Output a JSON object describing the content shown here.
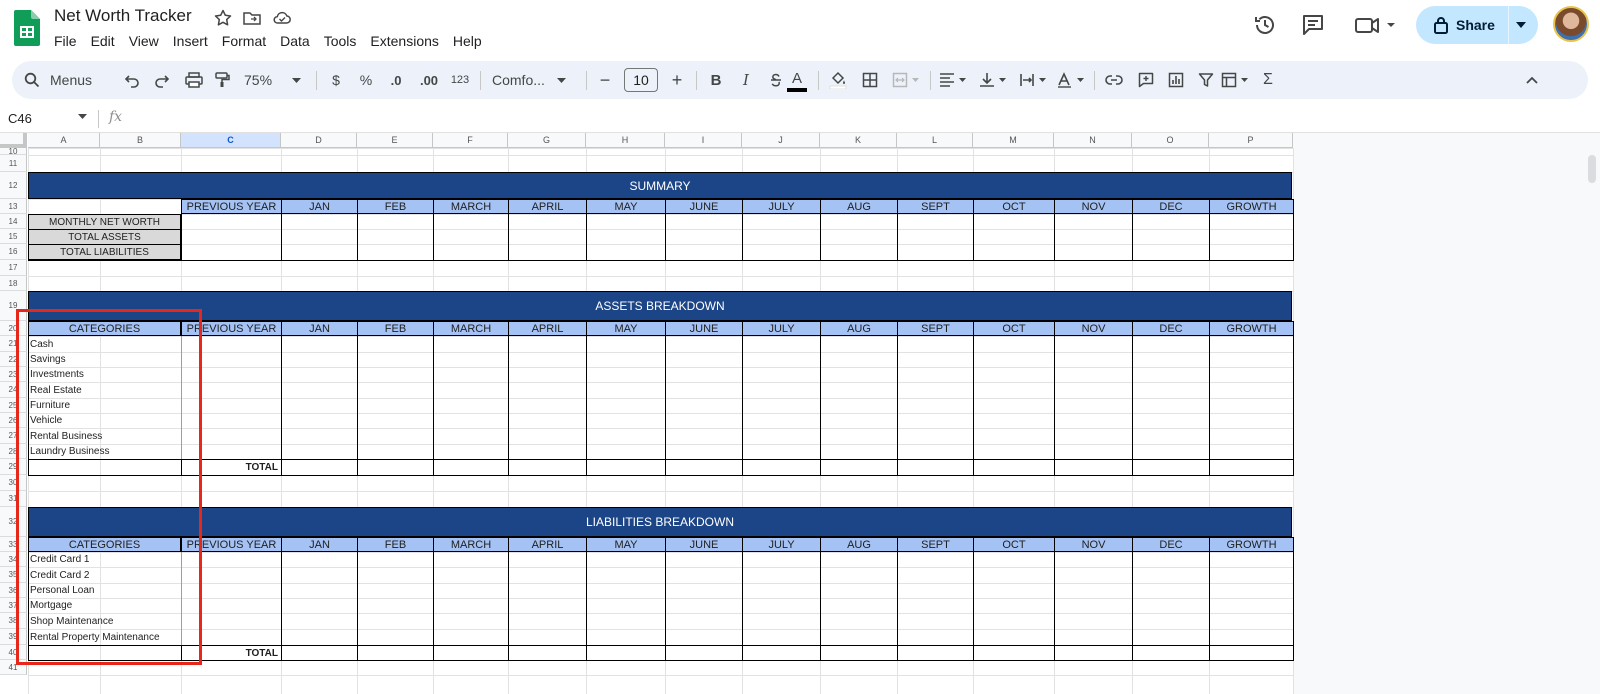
{
  "app": {
    "title": "Net Worth Tracker",
    "menu": [
      "File",
      "Edit",
      "View",
      "Insert",
      "Format",
      "Data",
      "Tools",
      "Extensions",
      "Help"
    ],
    "share_label": "Share"
  },
  "toolbar": {
    "search_label": "Menus",
    "zoom": "75%",
    "currency": "$",
    "percent": "%",
    "dec_decrease": ".0",
    "dec_increase": ".00",
    "number_format": "123",
    "font_name": "Comfo...",
    "font_size": "10",
    "minus": "−",
    "plus": "+",
    "bold": "B",
    "italic": "I",
    "text_color_glyph": "A",
    "sum_glyph": "Σ"
  },
  "formula_bar": {
    "cell_ref": "C46",
    "fx": "fx"
  },
  "columns": [
    "A",
    "B",
    "C",
    "D",
    "E",
    "F",
    "G",
    "H",
    "I",
    "J",
    "K",
    "L",
    "M",
    "N",
    "O",
    "P"
  ],
  "selected_column": "C",
  "rows": [
    "10",
    "11",
    "12",
    "13",
    "14",
    "15",
    "16",
    "17",
    "18",
    "19",
    "20",
    "21",
    "22",
    "23",
    "24",
    "25",
    "26",
    "27",
    "28",
    "29",
    "30",
    "31",
    "32",
    "33",
    "34",
    "35",
    "36",
    "37",
    "38",
    "39",
    "40",
    "41"
  ],
  "header_cols": [
    "PREVIOUS YEAR",
    "JAN",
    "FEB",
    "MARCH",
    "APRIL",
    "MAY",
    "JUNE",
    "JULY",
    "AUG",
    "SEPT",
    "OCT",
    "NOV",
    "DEC",
    "GROWTH"
  ],
  "summary": {
    "title": "SUMMARY",
    "labels": [
      "MONTHLY NET WORTH",
      "TOTAL ASSETS",
      "TOTAL LIABILITIES"
    ]
  },
  "assets": {
    "title": "ASSETS BREAKDOWN",
    "categories_label": "CATEGORIES",
    "items": [
      "Cash",
      "Savings",
      "Investments",
      "Real Estate",
      "Furniture",
      "Vehicle",
      "Rental Business",
      "Laundry Business"
    ],
    "total_label": "TOTAL"
  },
  "liabilities": {
    "title": "LIABILITIES BREAKDOWN",
    "categories_label": "CATEGORIES",
    "items": [
      "Credit Card 1",
      "Credit Card 2",
      "Personal Loan",
      "Mortgage",
      "Shop Maintenance",
      "Rental Property Maintenance"
    ],
    "total_label": "TOTAL"
  },
  "colors": {
    "band": "#1c4587",
    "header": "#a4c2f4",
    "gray_label": "#d9d9d9",
    "highlight_box": "#e8271b",
    "share_bg": "#c2e7ff"
  }
}
